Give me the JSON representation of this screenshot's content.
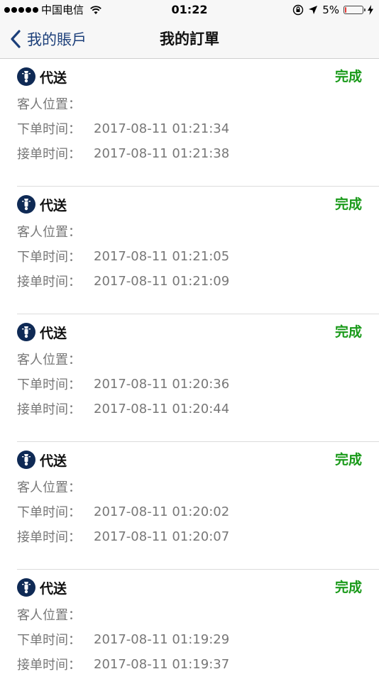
{
  "status_bar": {
    "carrier": "中国电信",
    "time": "01:22",
    "battery_percent": "5%",
    "battery_level": 0.05
  },
  "nav": {
    "back_label": "我的賬戶",
    "title": "我的訂單"
  },
  "colors": {
    "nav_blue": "#1c3f7a",
    "status_green": "#1a9a1a",
    "icon_navy": "#0f2a55",
    "battery_red": "#e53935"
  },
  "labels": {
    "location": "客人位置：",
    "order_time": "下单时间：",
    "accept_time": "接单时间："
  },
  "orders": [
    {
      "type": "代送",
      "status": "完成",
      "location": "",
      "order_time": "2017-08-11 01:21:34",
      "accept_time": "2017-08-11 01:21:38"
    },
    {
      "type": "代送",
      "status": "完成",
      "location": "",
      "order_time": "2017-08-11 01:21:05",
      "accept_time": "2017-08-11 01:21:09"
    },
    {
      "type": "代送",
      "status": "完成",
      "location": "",
      "order_time": "2017-08-11 01:20:36",
      "accept_time": "2017-08-11 01:20:44"
    },
    {
      "type": "代送",
      "status": "完成",
      "location": "",
      "order_time": "2017-08-11 01:20:02",
      "accept_time": "2017-08-11 01:20:07"
    },
    {
      "type": "代送",
      "status": "完成",
      "location": "",
      "order_time": "2017-08-11 01:19:29",
      "accept_time": "2017-08-11 01:19:37"
    }
  ]
}
